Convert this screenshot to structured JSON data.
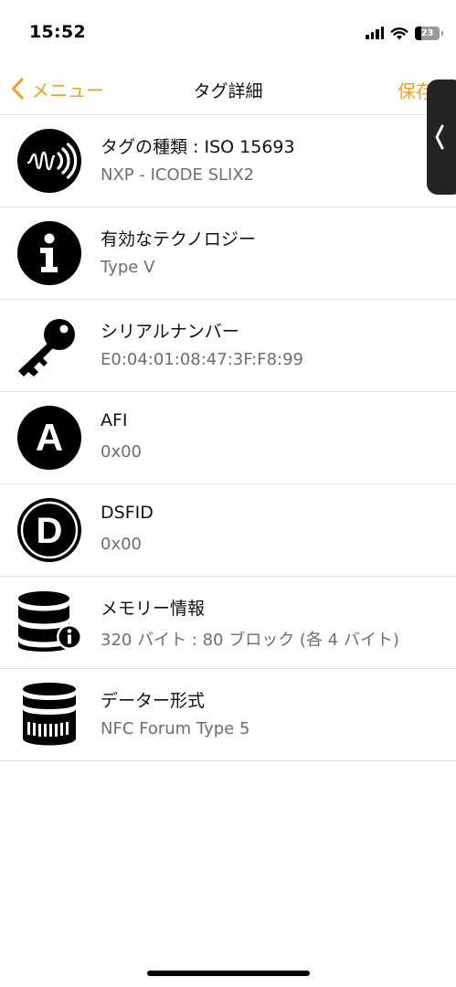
{
  "status_bar": {
    "time": "15:52",
    "battery_percent": "23",
    "icons": [
      "cellular-signal-icon",
      "wifi-icon",
      "battery-icon"
    ]
  },
  "nav": {
    "back_label": "メニュー",
    "title": "タグ詳細",
    "save_label": "保存",
    "accent_color": "#f2a128"
  },
  "side_handle": {
    "icon": "chevron-left-icon"
  },
  "rows": [
    {
      "icon": "nfc-tag-icon",
      "title": "タグの種類 : ISO 15693",
      "value": "NXP - ICODE SLIX2"
    },
    {
      "icon": "info-icon",
      "title": "有効なテクノロジー",
      "value": "Type V"
    },
    {
      "icon": "key-icon",
      "title": "シリアルナンバー",
      "value": "E0:04:01:08:47:3F:F8:99"
    },
    {
      "icon": "letter-a-icon",
      "title": "AFI",
      "value": "0x00"
    },
    {
      "icon": "letter-d-icon",
      "title": "DSFID",
      "value": "0x00"
    },
    {
      "icon": "database-info-icon",
      "title": "メモリー情報",
      "value": "320 バイト : 80 ブロック (各 4 バイト)"
    },
    {
      "icon": "database-format-icon",
      "title": "データー形式",
      "value": "NFC Forum Type 5"
    }
  ]
}
